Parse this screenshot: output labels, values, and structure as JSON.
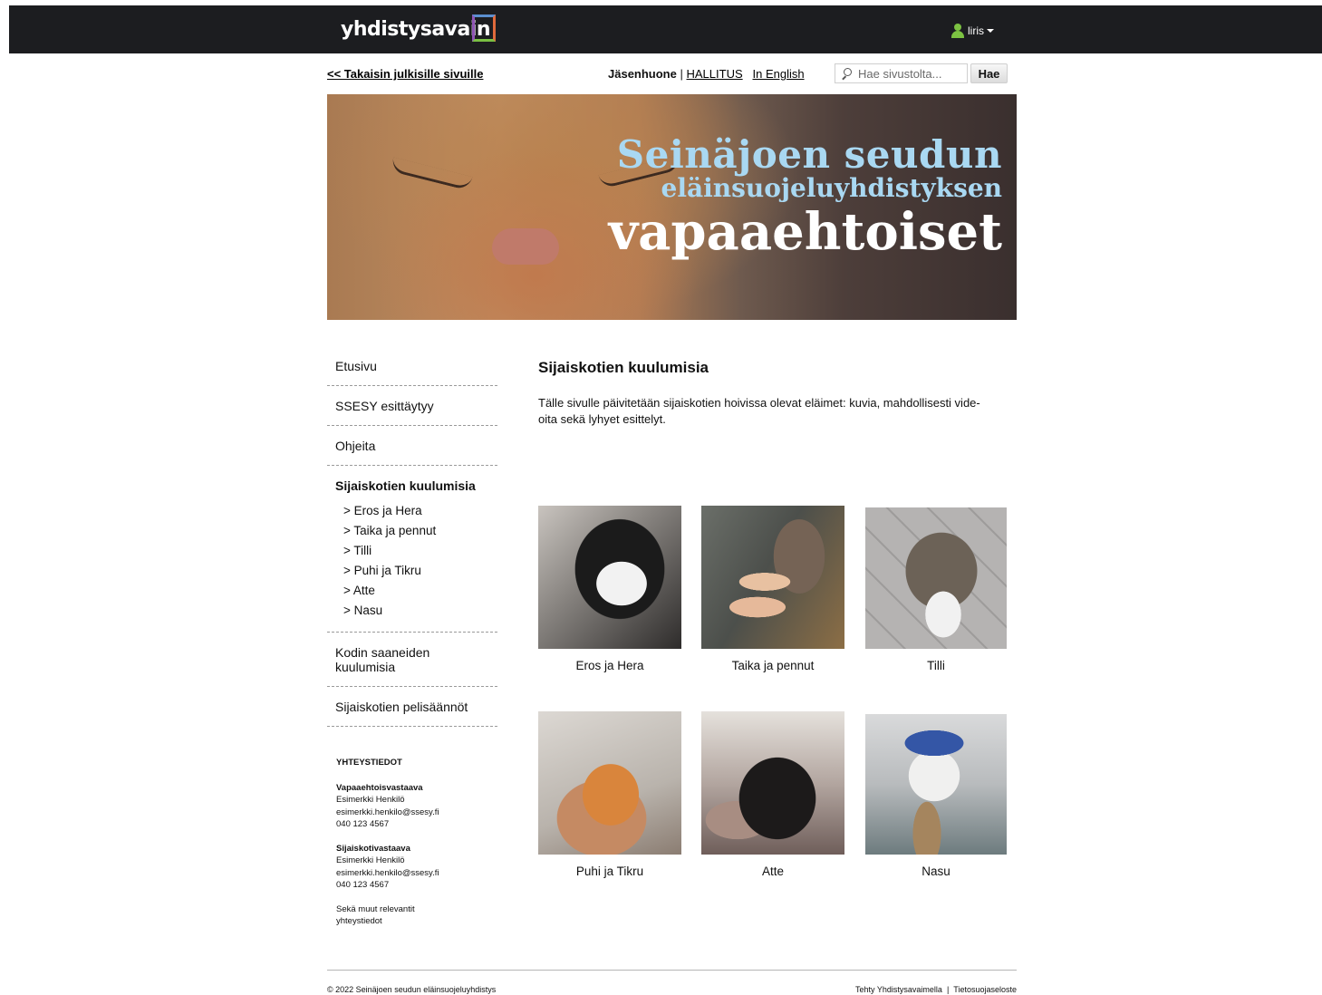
{
  "topbar": {
    "logo_text": "yhdistysavain",
    "user_name": "liris"
  },
  "subnav": {
    "back_link": "<< Takaisin julkisille sivuille",
    "member_room": "Jäsenhuone",
    "separator": "|",
    "board": "HALLITUS",
    "english": "In English",
    "search_placeholder": "Hae sivustolta...",
    "search_button": "Hae"
  },
  "banner": {
    "line1": "Seinäjoen seudun",
    "line2": "eläinsuojeluyhdistyksen",
    "line3": "vapaaehtoiset"
  },
  "sidebar": {
    "items": [
      {
        "label": "Etusivu"
      },
      {
        "label": "SSESY esittäytyy"
      },
      {
        "label": "Ohjeita"
      }
    ],
    "active": {
      "label": "Sijaiskotien kuulumisia"
    },
    "subitems": [
      {
        "label": "> Eros ja Hera"
      },
      {
        "label": "> Taika ja pennut"
      },
      {
        "label": "> Tilli"
      },
      {
        "label": "> Puhi ja Tikru"
      },
      {
        "label": "> Atte"
      },
      {
        "label": "> Nasu"
      }
    ],
    "after": [
      {
        "label": "Kodin saaneiden kuulumisia"
      },
      {
        "label": "Sijaiskotien pelisäännöt"
      }
    ]
  },
  "contact": {
    "heading": "YHTEYSTIEDOT",
    "volunteer_role": "Vapaaehtoisvastaava",
    "volunteer_name": "Esimerkki Henkilö",
    "volunteer_email": "esimerkki.henkilo@ssesy.fi",
    "volunteer_phone": "040 123 4567",
    "foster_role": "Sijaiskotivastaava",
    "foster_name": "Esimerkki Henkilö",
    "foster_email": "esimerkki.henkilo@ssesy.fi",
    "foster_phone": "040 123 4567",
    "other_line1": "Sekä muut relevantit",
    "other_line2": "yhteystiedot"
  },
  "main": {
    "title": "Sijaiskotien kuulumisia",
    "intro_line1": "Tälle sivulle päivitetään sijaiskotien hoivissa olevat eläimet: kuvia, mahdollisesti vide-",
    "intro_line2": "oita sekä lyhyet esittelyt."
  },
  "gallery": [
    {
      "caption": "Eros ja Hera"
    },
    {
      "caption": "Taika ja pennut"
    },
    {
      "caption": "Tilli"
    },
    {
      "caption": "Puhi ja Tikru"
    },
    {
      "caption": "Atte"
    },
    {
      "caption": "Nasu"
    }
  ],
  "footer": {
    "copyright": "© 2022 Seinäjoen seudun eläinsuojeluyhdistys",
    "made_with": "Tehty Yhdistysavaimella",
    "separator": "|",
    "privacy": "Tietosuojaseloste"
  },
  "colors": {
    "topbar": "#1c1d20",
    "banner_title": "#a9d8f2",
    "user_icon": "#7cc242"
  }
}
